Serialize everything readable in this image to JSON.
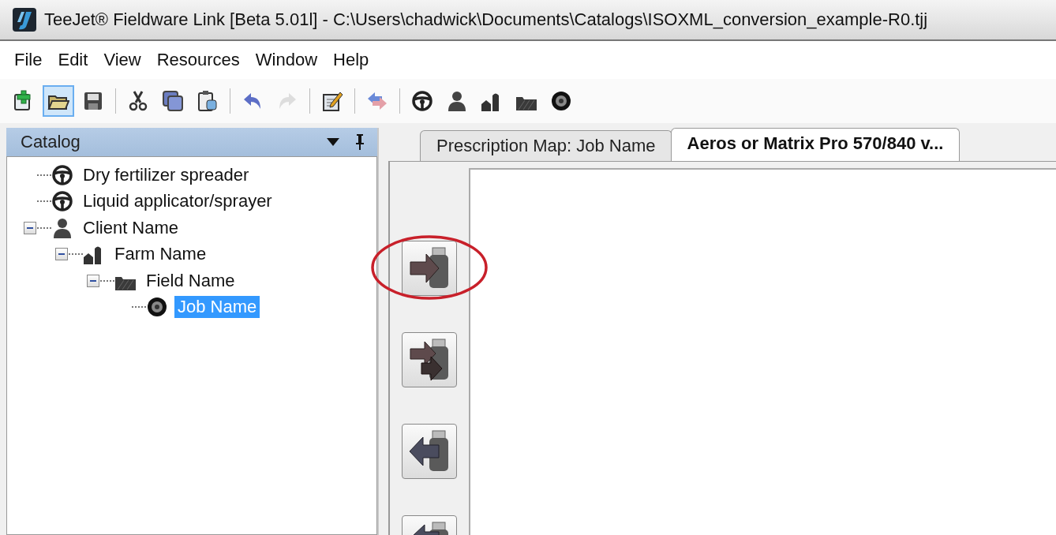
{
  "window": {
    "title": "TeeJet® Fieldware Link [Beta 5.01l] - C:\\Users\\chadwick\\Documents\\Catalogs\\ISOXML_conversion_example-R0.tjj"
  },
  "menu": [
    "File",
    "Edit",
    "View",
    "Resources",
    "Window",
    "Help"
  ],
  "toolbar": [
    {
      "items": [
        {
          "kind": "new",
          "pressed": false,
          "disabled": false
        },
        {
          "kind": "open",
          "pressed": true,
          "disabled": false
        },
        {
          "kind": "save",
          "pressed": false,
          "disabled": false
        }
      ]
    },
    {
      "items": [
        {
          "kind": "cut",
          "pressed": false,
          "disabled": false
        },
        {
          "kind": "copy",
          "pressed": false,
          "disabled": false
        },
        {
          "kind": "paste",
          "pressed": false,
          "disabled": false
        }
      ]
    },
    {
      "items": [
        {
          "kind": "undo",
          "pressed": false,
          "disabled": false
        },
        {
          "kind": "redo",
          "pressed": false,
          "disabled": true
        }
      ]
    },
    {
      "items": [
        {
          "kind": "edit",
          "pressed": false,
          "disabled": false
        }
      ]
    },
    {
      "items": [
        {
          "kind": "convert",
          "pressed": false,
          "disabled": false
        }
      ]
    },
    {
      "items": [
        {
          "kind": "equipment",
          "pressed": false,
          "disabled": false
        },
        {
          "kind": "client",
          "pressed": false,
          "disabled": false
        },
        {
          "kind": "farm",
          "pressed": false,
          "disabled": false
        },
        {
          "kind": "field",
          "pressed": false,
          "disabled": false
        },
        {
          "kind": "job",
          "pressed": false,
          "disabled": false
        }
      ]
    }
  ],
  "catalog": {
    "title": "Catalog",
    "tree": [
      {
        "label": "Dry fertilizer spreader",
        "kind": "equipment",
        "selected": false
      },
      {
        "label": "Liquid applicator/sprayer",
        "kind": "equipment",
        "selected": false
      },
      {
        "label": "Client Name",
        "kind": "client",
        "selected": false,
        "expanded": true,
        "children": [
          {
            "label": "Farm Name",
            "kind": "farm",
            "selected": false,
            "expanded": true,
            "children": [
              {
                "label": "Field Name",
                "kind": "field",
                "selected": false,
                "expanded": true,
                "children": [
                  {
                    "label": "Job Name",
                    "kind": "job",
                    "selected": true
                  }
                ]
              }
            ]
          }
        ]
      }
    ]
  },
  "tabs": [
    {
      "label": "Prescription Map: Job Name",
      "selected": false
    },
    {
      "label": "Aeros or Matrix Pro 570/840 v...",
      "selected": true
    }
  ],
  "side_buttons": [
    {
      "kind": "send",
      "highlighted": true
    },
    {
      "kind": "send-all",
      "highlighted": false
    },
    {
      "kind": "receive",
      "highlighted": false
    },
    {
      "kind": "receive-all",
      "highlighted": false
    }
  ]
}
